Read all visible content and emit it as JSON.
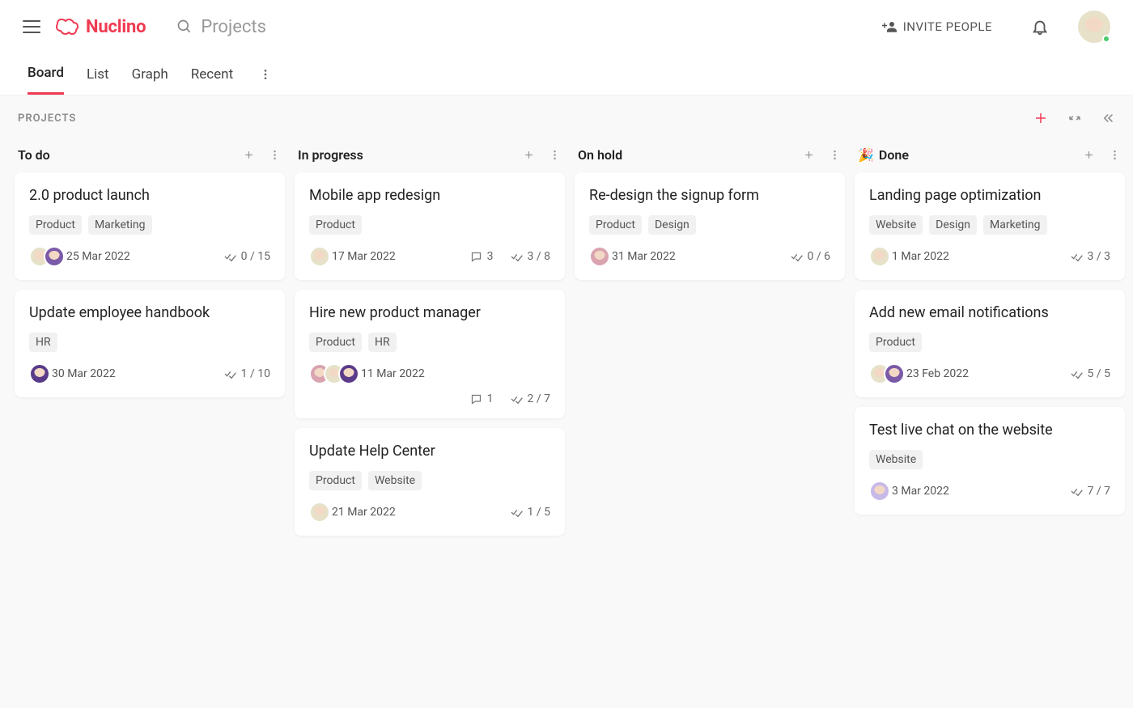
{
  "header": {
    "logo_text": "Nuclino",
    "search_placeholder": "Projects",
    "invite_label": "INVITE PEOPLE"
  },
  "tabs": {
    "items": [
      "Board",
      "List",
      "Graph",
      "Recent"
    ],
    "active": "Board"
  },
  "board": {
    "breadcrumb": "PROJECTS",
    "columns": [
      {
        "title": "To do",
        "emoji": "",
        "cards": [
          {
            "title": "2.0 product launch",
            "tags": [
              "Product",
              "Marketing"
            ],
            "avatars": [
              "av-a",
              "av-b"
            ],
            "date": "25 Mar 2022",
            "comments": null,
            "tasks": "0 / 15"
          },
          {
            "title": "Update employee handbook",
            "tags": [
              "HR"
            ],
            "avatars": [
              "av-d"
            ],
            "date": "30 Mar 2022",
            "comments": null,
            "tasks": "1 / 10"
          }
        ]
      },
      {
        "title": "In progress",
        "emoji": "",
        "cards": [
          {
            "title": "Mobile app redesign",
            "tags": [
              "Product"
            ],
            "avatars": [
              "av-a"
            ],
            "date": "17 Mar 2022",
            "comments": "3",
            "tasks": "3 / 8"
          },
          {
            "title": "Hire new product manager",
            "tags": [
              "Product",
              "HR"
            ],
            "avatars": [
              "av-c",
              "av-a",
              "av-d"
            ],
            "date": "11 Mar 2022",
            "comments": "1",
            "tasks": "2 / 7",
            "second_row": true
          },
          {
            "title": "Update Help Center",
            "tags": [
              "Product",
              "Website"
            ],
            "avatars": [
              "av-a"
            ],
            "date": "21 Mar 2022",
            "comments": null,
            "tasks": "1 / 5"
          }
        ]
      },
      {
        "title": "On hold",
        "emoji": "",
        "cards": [
          {
            "title": "Re-design the signup form",
            "tags": [
              "Product",
              "Design"
            ],
            "avatars": [
              "av-c"
            ],
            "date": "31 Mar 2022",
            "comments": null,
            "tasks": "0 / 6"
          }
        ]
      },
      {
        "title": "Done",
        "emoji": "🎉",
        "cards": [
          {
            "title": "Landing page optimization",
            "tags": [
              "Website",
              "Design",
              "Marketing"
            ],
            "avatars": [
              "av-a"
            ],
            "date": "1 Mar 2022",
            "comments": null,
            "tasks": "3 / 3"
          },
          {
            "title": "Add new email notifications",
            "tags": [
              "Product"
            ],
            "avatars": [
              "av-a",
              "av-b"
            ],
            "date": "23 Feb 2022",
            "comments": null,
            "tasks": "5 / 5"
          },
          {
            "title": "Test live chat on the website",
            "tags": [
              "Website"
            ],
            "avatars": [
              "av-e"
            ],
            "date": "3 Mar 2022",
            "comments": null,
            "tasks": "7 / 7"
          }
        ]
      }
    ]
  }
}
